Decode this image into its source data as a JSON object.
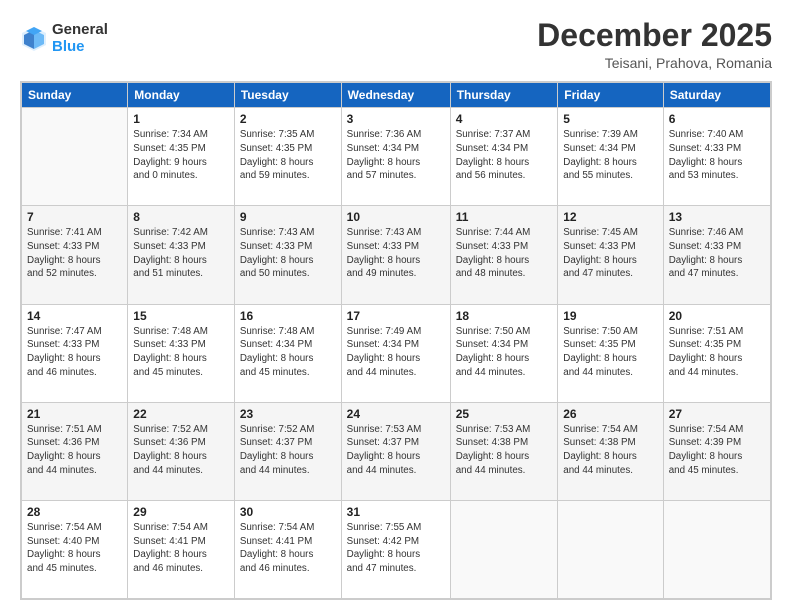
{
  "header": {
    "logo_general": "General",
    "logo_blue": "Blue",
    "title": "December 2025",
    "subtitle": "Teisani, Prahova, Romania"
  },
  "days_of_week": [
    "Sunday",
    "Monday",
    "Tuesday",
    "Wednesday",
    "Thursday",
    "Friday",
    "Saturday"
  ],
  "weeks": [
    [
      {
        "day": "",
        "info": ""
      },
      {
        "day": "1",
        "info": "Sunrise: 7:34 AM\nSunset: 4:35 PM\nDaylight: 9 hours\nand 0 minutes."
      },
      {
        "day": "2",
        "info": "Sunrise: 7:35 AM\nSunset: 4:35 PM\nDaylight: 8 hours\nand 59 minutes."
      },
      {
        "day": "3",
        "info": "Sunrise: 7:36 AM\nSunset: 4:34 PM\nDaylight: 8 hours\nand 57 minutes."
      },
      {
        "day": "4",
        "info": "Sunrise: 7:37 AM\nSunset: 4:34 PM\nDaylight: 8 hours\nand 56 minutes."
      },
      {
        "day": "5",
        "info": "Sunrise: 7:39 AM\nSunset: 4:34 PM\nDaylight: 8 hours\nand 55 minutes."
      },
      {
        "day": "6",
        "info": "Sunrise: 7:40 AM\nSunset: 4:33 PM\nDaylight: 8 hours\nand 53 minutes."
      }
    ],
    [
      {
        "day": "7",
        "info": "Sunrise: 7:41 AM\nSunset: 4:33 PM\nDaylight: 8 hours\nand 52 minutes."
      },
      {
        "day": "8",
        "info": "Sunrise: 7:42 AM\nSunset: 4:33 PM\nDaylight: 8 hours\nand 51 minutes."
      },
      {
        "day": "9",
        "info": "Sunrise: 7:43 AM\nSunset: 4:33 PM\nDaylight: 8 hours\nand 50 minutes."
      },
      {
        "day": "10",
        "info": "Sunrise: 7:43 AM\nSunset: 4:33 PM\nDaylight: 8 hours\nand 49 minutes."
      },
      {
        "day": "11",
        "info": "Sunrise: 7:44 AM\nSunset: 4:33 PM\nDaylight: 8 hours\nand 48 minutes."
      },
      {
        "day": "12",
        "info": "Sunrise: 7:45 AM\nSunset: 4:33 PM\nDaylight: 8 hours\nand 47 minutes."
      },
      {
        "day": "13",
        "info": "Sunrise: 7:46 AM\nSunset: 4:33 PM\nDaylight: 8 hours\nand 47 minutes."
      }
    ],
    [
      {
        "day": "14",
        "info": "Sunrise: 7:47 AM\nSunset: 4:33 PM\nDaylight: 8 hours\nand 46 minutes."
      },
      {
        "day": "15",
        "info": "Sunrise: 7:48 AM\nSunset: 4:33 PM\nDaylight: 8 hours\nand 45 minutes."
      },
      {
        "day": "16",
        "info": "Sunrise: 7:48 AM\nSunset: 4:34 PM\nDaylight: 8 hours\nand 45 minutes."
      },
      {
        "day": "17",
        "info": "Sunrise: 7:49 AM\nSunset: 4:34 PM\nDaylight: 8 hours\nand 44 minutes."
      },
      {
        "day": "18",
        "info": "Sunrise: 7:50 AM\nSunset: 4:34 PM\nDaylight: 8 hours\nand 44 minutes."
      },
      {
        "day": "19",
        "info": "Sunrise: 7:50 AM\nSunset: 4:35 PM\nDaylight: 8 hours\nand 44 minutes."
      },
      {
        "day": "20",
        "info": "Sunrise: 7:51 AM\nSunset: 4:35 PM\nDaylight: 8 hours\nand 44 minutes."
      }
    ],
    [
      {
        "day": "21",
        "info": "Sunrise: 7:51 AM\nSunset: 4:36 PM\nDaylight: 8 hours\nand 44 minutes."
      },
      {
        "day": "22",
        "info": "Sunrise: 7:52 AM\nSunset: 4:36 PM\nDaylight: 8 hours\nand 44 minutes."
      },
      {
        "day": "23",
        "info": "Sunrise: 7:52 AM\nSunset: 4:37 PM\nDaylight: 8 hours\nand 44 minutes."
      },
      {
        "day": "24",
        "info": "Sunrise: 7:53 AM\nSunset: 4:37 PM\nDaylight: 8 hours\nand 44 minutes."
      },
      {
        "day": "25",
        "info": "Sunrise: 7:53 AM\nSunset: 4:38 PM\nDaylight: 8 hours\nand 44 minutes."
      },
      {
        "day": "26",
        "info": "Sunrise: 7:54 AM\nSunset: 4:38 PM\nDaylight: 8 hours\nand 44 minutes."
      },
      {
        "day": "27",
        "info": "Sunrise: 7:54 AM\nSunset: 4:39 PM\nDaylight: 8 hours\nand 45 minutes."
      }
    ],
    [
      {
        "day": "28",
        "info": "Sunrise: 7:54 AM\nSunset: 4:40 PM\nDaylight: 8 hours\nand 45 minutes."
      },
      {
        "day": "29",
        "info": "Sunrise: 7:54 AM\nSunset: 4:41 PM\nDaylight: 8 hours\nand 46 minutes."
      },
      {
        "day": "30",
        "info": "Sunrise: 7:54 AM\nSunset: 4:41 PM\nDaylight: 8 hours\nand 46 minutes."
      },
      {
        "day": "31",
        "info": "Sunrise: 7:55 AM\nSunset: 4:42 PM\nDaylight: 8 hours\nand 47 minutes."
      },
      {
        "day": "",
        "info": ""
      },
      {
        "day": "",
        "info": ""
      },
      {
        "day": "",
        "info": ""
      }
    ]
  ]
}
